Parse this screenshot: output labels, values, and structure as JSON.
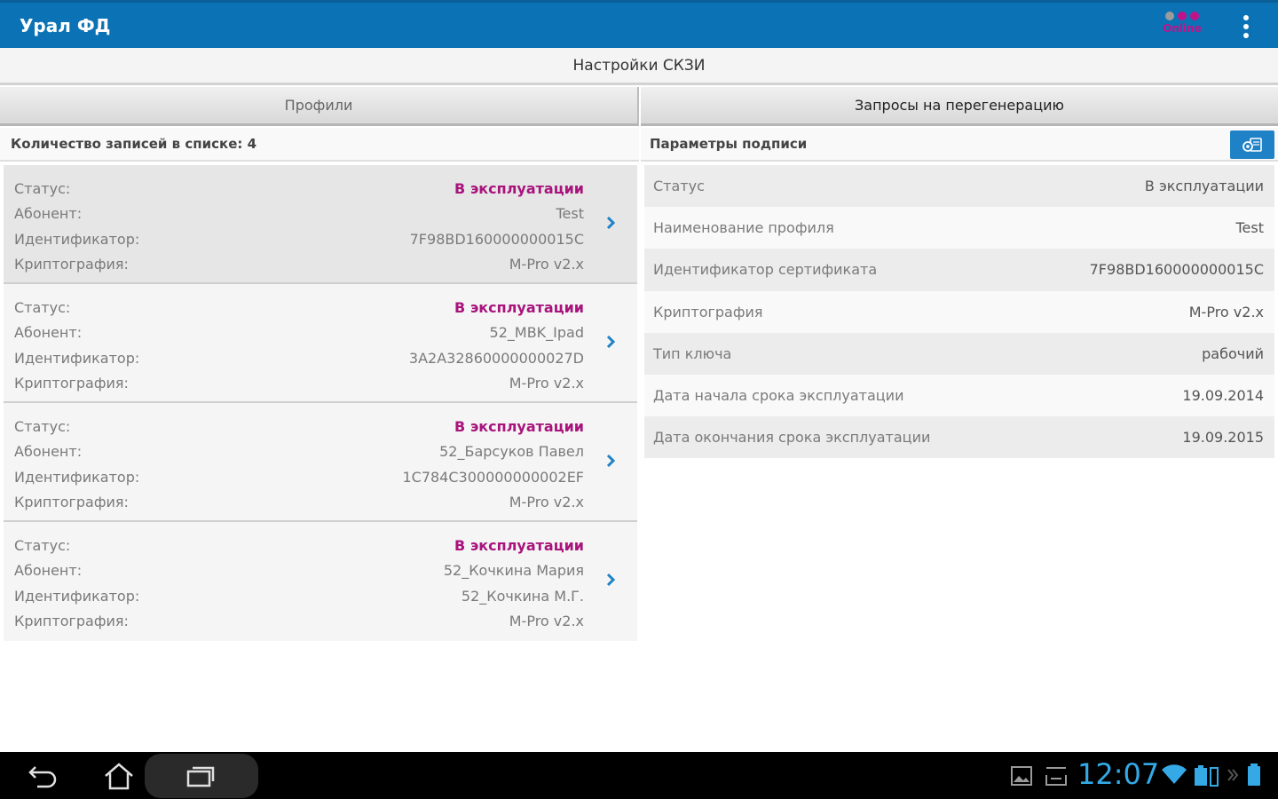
{
  "app": {
    "title": "Урал ФД"
  },
  "online_badge": {
    "label": "Online",
    "colors": [
      "#9b9b9b",
      "#c0138a",
      "#c0138a"
    ]
  },
  "section_title": "Настройки СКЗИ",
  "tabs": [
    {
      "label": "Профили"
    },
    {
      "label": "Запросы на перегенерацию"
    }
  ],
  "list_header": "Количество записей в списке: 4",
  "params_header": "Параметры подписи",
  "field_labels": {
    "status": "Статус:",
    "subscriber": "Абонент:",
    "identifier": "Идентификатор:",
    "crypto": "Криптография:"
  },
  "profiles": [
    {
      "status": "В эксплуатации",
      "subscriber": "Test",
      "identifier": "7F98BD160000000015C",
      "crypto": "M-Pro v2.x"
    },
    {
      "status": "В эксплуатации",
      "subscriber": "52_MBK_Ipad",
      "identifier": "3A2A32860000000027D",
      "crypto": "M-Pro v2.x"
    },
    {
      "status": "В эксплуатации",
      "subscriber": "52_Барсуков Павел",
      "identifier": "1C784C300000000002EF",
      "crypto": "M-Pro v2.x"
    },
    {
      "status": "В эксплуатации",
      "subscriber": "52_Кочкина Мария",
      "identifier": "52_Кочкина М.Г.",
      "crypto": "M-Pro v2.x"
    }
  ],
  "params": [
    {
      "label": "Статус",
      "value": "В эксплуатации"
    },
    {
      "label": "Наименование профиля",
      "value": "Test"
    },
    {
      "label": "Идентификатор сертификата",
      "value": "7F98BD160000000015C"
    },
    {
      "label": "Криптография",
      "value": "M-Pro v2.x"
    },
    {
      "label": "Тип ключа",
      "value": "рабочий"
    },
    {
      "label": "Дата начала срока эксплуатации",
      "value": "19.09.2014"
    },
    {
      "label": "Дата окончания срока эксплуатации",
      "value": "19.09.2015"
    }
  ],
  "system_bar": {
    "time": "12:07"
  },
  "colors": {
    "accent": "#0b72b5",
    "status": "#a8147c",
    "clock": "#34a9e6"
  }
}
